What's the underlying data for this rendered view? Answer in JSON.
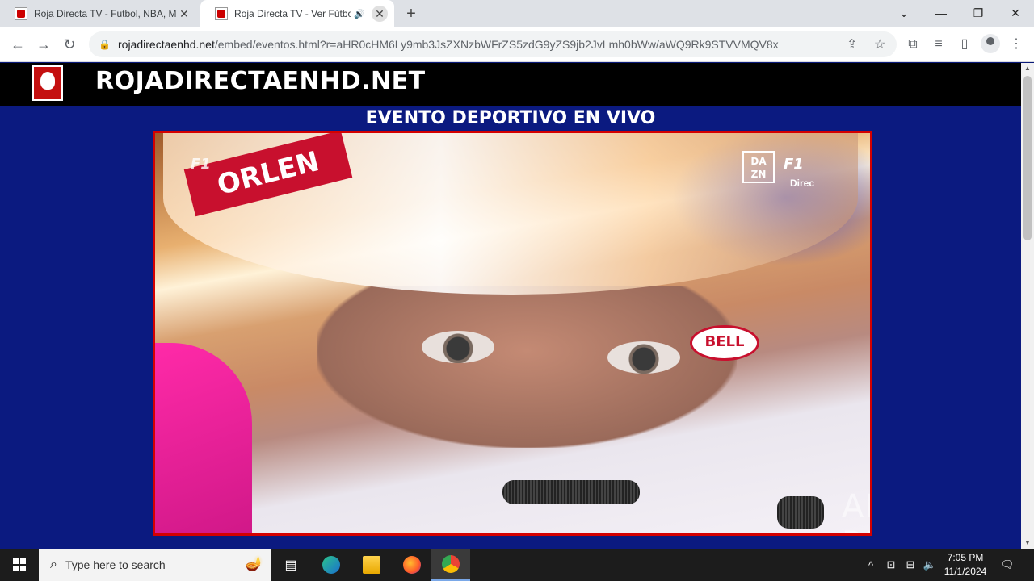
{
  "browser": {
    "tabs": [
      {
        "title": "Roja Directa TV - Futbol, NBA, M",
        "close": "✕"
      },
      {
        "title": "Roja Directa TV - Ver Fútbol",
        "close": "✕"
      }
    ],
    "new_tab": "+",
    "window": {
      "dropdown": "⌄",
      "minimize": "—",
      "restore": "❐",
      "close": "✕"
    },
    "nav": {
      "back": "←",
      "forward": "→",
      "reload": "↻"
    },
    "url_host": "rojadirectaenhd.net",
    "url_path": "/embed/eventos.html?r=aHR0cHM6Ly9mb3JsZXNzbWFrZS5zdG9yZS9jb2JvLmh0bWw/aWQ9Rk9STVVMQV8x"
  },
  "site": {
    "name": "ROJADIRECTAENHD.NET",
    "event_title": "EVENTO DEPORTIVO EN VIVO"
  },
  "video": {
    "sponsor": "ORLEN",
    "helmet_brand": "BELL",
    "broadcaster": "DA ZN",
    "f1_logo": "F1",
    "live_label": "Direc",
    "watermark": "ANY RUN"
  },
  "taskbar": {
    "search_placeholder": "Type here to search",
    "time": "7:05 PM",
    "date": "11/1/2024"
  }
}
